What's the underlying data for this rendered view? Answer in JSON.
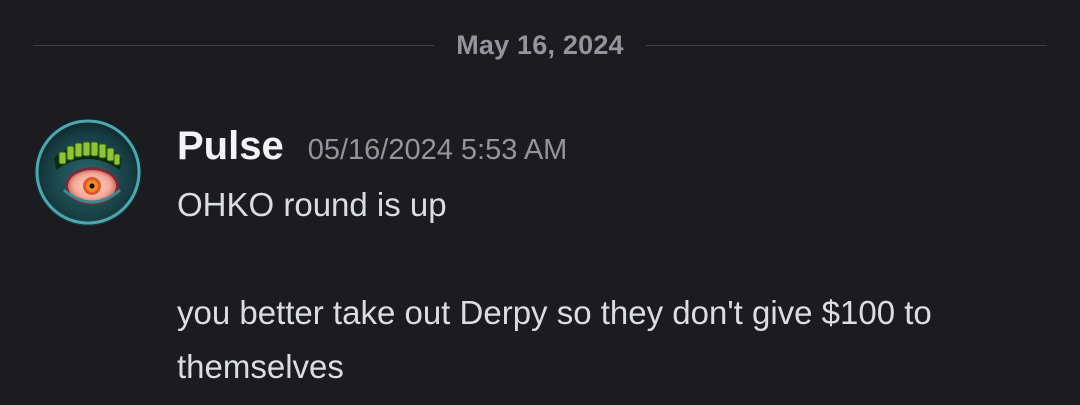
{
  "divider": {
    "date": "May 16, 2024"
  },
  "message": {
    "author": "Pulse",
    "timestamp": "05/16/2024 5:53 AM",
    "lines": [
      "OHKO round is up",
      "you better take out Derpy so they don't give $100 to themselves"
    ]
  },
  "colors": {
    "background": "#1b1b20",
    "username": "#f2f3f5",
    "muted": "#94959c",
    "text": "#dbdee1",
    "divider_line": "#3f4147"
  },
  "icons": {
    "avatar": "eye-monster-avatar"
  }
}
